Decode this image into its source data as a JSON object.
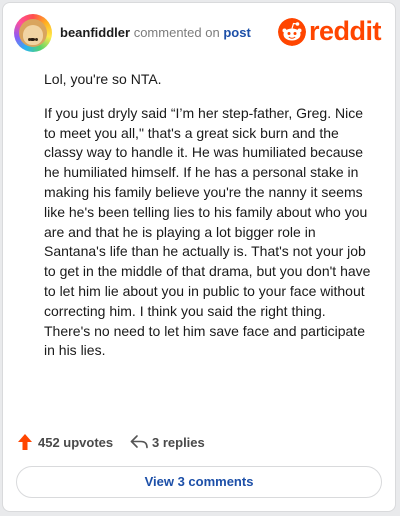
{
  "colors": {
    "brand": "#ff4500",
    "link": "#1c4fa8",
    "upvote": "#ff4500"
  },
  "header": {
    "avatar_icon": "doge-avatar-icon",
    "username": "beanfiddler",
    "commented_text": "commented on",
    "post_link": "post",
    "logo_icon": "reddit-snoo-icon",
    "logo_text": "reddit"
  },
  "comment": {
    "paragraphs": [
      "Lol, you're so NTA.",
      "If you just dryly said “I’m her step-father, Greg. Nice to meet you all,\" that's a great sick burn and the classy way to handle it. He was humiliated because he humiliated himself. If he has a personal stake in making his family believe you're the nanny it seems like he's been telling lies to his family about who you are and that he is playing a lot bigger role in Santana's life than he actually is. That's not your job to get in the middle of that drama, but you don't have to let him lie about you in public to your face without correcting him. I think you said the right thing. There's no need to let him save face and participate in his lies."
    ]
  },
  "actions": {
    "upvote_icon": "upvote-arrow-icon",
    "upvotes_label": "452 upvotes",
    "reply_icon": "reply-arrow-icon",
    "replies_label": "3 replies"
  },
  "footer": {
    "view_comments_label": "View 3 comments"
  }
}
